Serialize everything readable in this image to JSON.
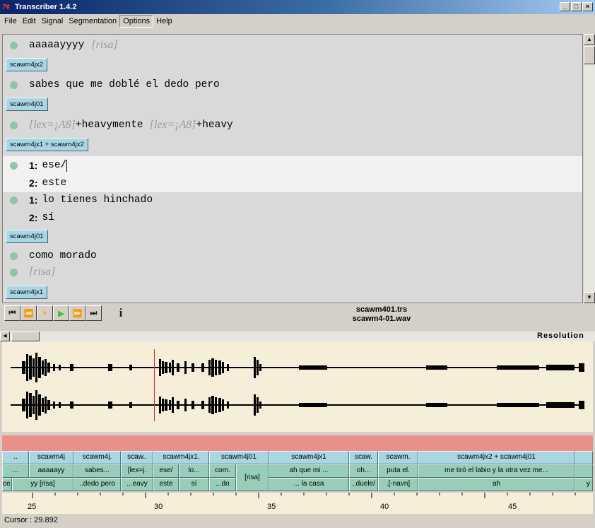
{
  "window": {
    "title": "Transcriber 1.4.2",
    "icon_text": "7¢",
    "controls": [
      "_",
      "□",
      "×"
    ]
  },
  "menu": [
    "File",
    "Edit",
    "Signal",
    "Segmentation",
    "Options",
    "Help"
  ],
  "transcript": {
    "line1": {
      "text": "aaaaayyyy",
      "event": "[risa]"
    },
    "spk1": "scawm4jx2",
    "line2": "sabes que me doblé el dedo pero",
    "spk2": "scawm4j01",
    "line3": {
      "e1": "[lex=¡A8]",
      "t1": "+heavymente",
      "e2": "[lex=¡A8]",
      "t2": "+heavy"
    },
    "spk3": "scawm4jx1 + scawm4jx2",
    "turn1": {
      "n1": "1:",
      "t1": "ese/",
      "n2": "2:",
      "t2": "este"
    },
    "turn2": {
      "n1": "1:",
      "t1": "lo tienes hinchado",
      "n2": "2:",
      "t2": "sí"
    },
    "spk4": "scawm4j01",
    "line4": "como morado",
    "line5": "[risa]",
    "spk5": "scawm4jx1"
  },
  "player": {
    "buttons": [
      "⏮",
      "⏪",
      "⏸",
      "▶",
      "⏩",
      "⏭"
    ],
    "info": "i",
    "trs_file": "scawm401.trs",
    "wav_file": "scawm4-01.wav"
  },
  "resolution_label": "Resolution",
  "segments": {
    "speakers": [
      "..",
      "scawm4j",
      "scawm4j.",
      "scaw..",
      "scawm4jx1.",
      "scawm4j01",
      "scawm4jx1",
      "scaw.",
      "scawm.",
      "scawm4jx2 + scawm4j01"
    ],
    "row2": [
      "...",
      "aaaaayy",
      "sabes...",
      "[lex=j.",
      "ese/",
      "lo...",
      "com.",
      "ah que mi ...",
      "oh...",
      "puta el.",
      "me tiró el labio y la otra vez me..."
    ],
    "risa": "[risa]",
    "row3": [
      "ce.",
      "yy [risa]",
      "..dedo pero",
      "...eavy",
      "este",
      "sí",
      "...do",
      "... la casa",
      "..duele/",
      ".[-navn]",
      "ah",
      "y"
    ]
  },
  "ruler": [
    "25",
    "30",
    "35",
    "40",
    "45"
  ],
  "status": "Cursor : 29.892"
}
